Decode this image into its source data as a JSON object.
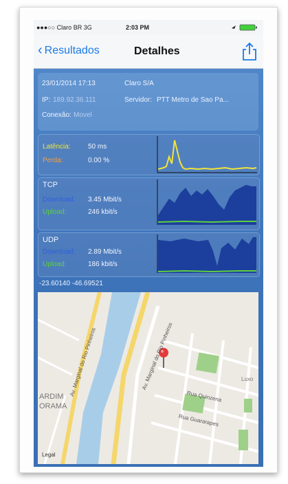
{
  "status_bar": {
    "carrier": "●●●○○ Claro BR  3G",
    "time": "2:03 PM"
  },
  "nav": {
    "back_label": "Resultados",
    "title": "Detalhes"
  },
  "info": {
    "datetime": "23/01/2014 17:13",
    "provider": "Claro S/A",
    "ip_label": "IP:",
    "ip_value": "189.92.36.111",
    "server_label": "Servidor:",
    "server_value": "PTT Metro de Sao Pa...",
    "connection_label": "Conexão:",
    "connection_value": "Movel"
  },
  "latency_card": {
    "latency_label": "Latência:",
    "latency_value": "50 ms",
    "loss_label": "Perda:",
    "loss_value": "0.00 %"
  },
  "tcp_card": {
    "title": "TCP",
    "download_label": "Download:",
    "download_value": "3.45 Mbit/s",
    "upload_label": "Upload:",
    "upload_value": "246 kbit/s"
  },
  "udp_card": {
    "title": "UDP",
    "download_label": "Download:",
    "download_value": "2.89 Mbit/s",
    "upload_label": "Upload:",
    "upload_value": "186 kbit/s"
  },
  "coordinates": "-23.60140   -46.69521",
  "map": {
    "street_1": "Av. Marginal do Rio Pinheiros",
    "street_2": "Av. Marginal do Rio Pinheiros",
    "street_3": "Rua Quinzena",
    "street_4": "Rua Guararapes",
    "area_1": "ARDIM",
    "area_2": "ORAMA",
    "corner_label": "Legal",
    "right_label": "Luxo"
  },
  "colors": {
    "accent": "#1a7ae6",
    "latency": "#f2e43a",
    "tcp_fill": "#1c3e9c",
    "upload": "#5fd13f",
    "pin": "#e23b3b"
  }
}
